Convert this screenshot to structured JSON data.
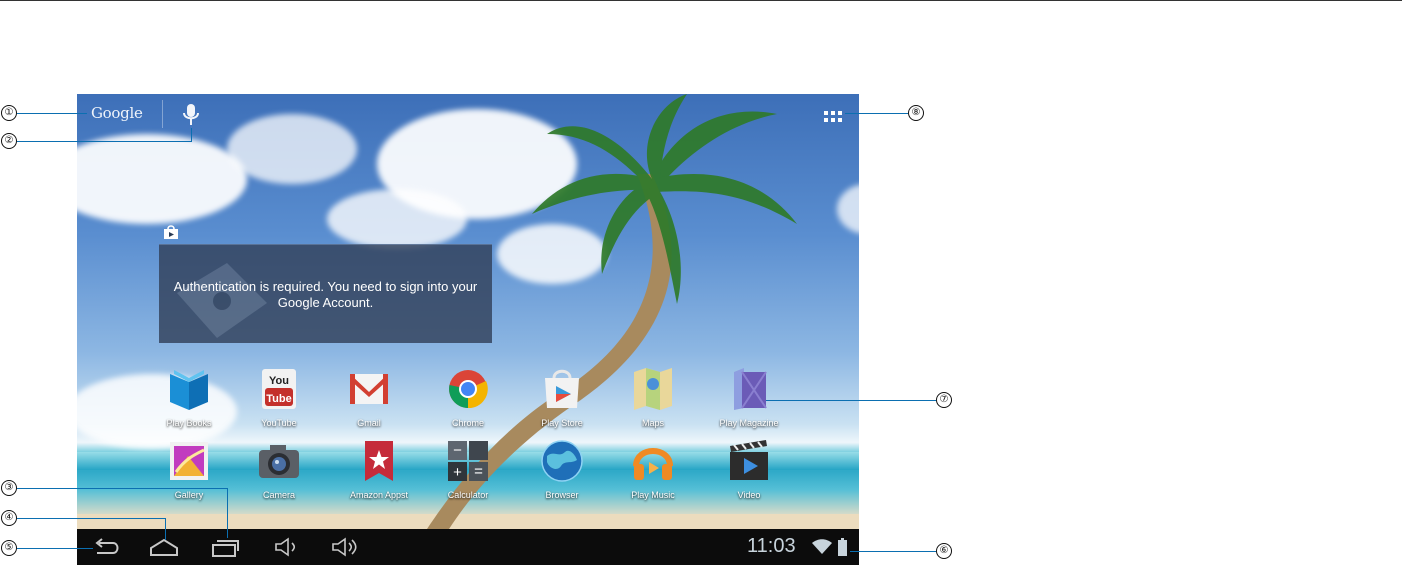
{
  "search": {
    "logo": "Google"
  },
  "widget": {
    "message": "Authentication is required. You need to sign into your Google Account."
  },
  "apps_row1": [
    {
      "label": "Play Books",
      "icon": "play-books-icon"
    },
    {
      "label": "YouTube",
      "icon": "youtube-icon"
    },
    {
      "label": "Gmail",
      "icon": "gmail-icon"
    },
    {
      "label": "Chrome",
      "icon": "chrome-icon"
    },
    {
      "label": "Play Store",
      "icon": "play-store-icon"
    },
    {
      "label": "Maps",
      "icon": "maps-icon"
    },
    {
      "label": "Play Magazine",
      "icon": "play-magazine-icon"
    }
  ],
  "apps_row2": [
    {
      "label": "Gallery",
      "icon": "gallery-icon"
    },
    {
      "label": "Camera",
      "icon": "camera-icon"
    },
    {
      "label": "Amazon Appst",
      "icon": "amazon-appstore-icon"
    },
    {
      "label": "Calculator",
      "icon": "calculator-icon"
    },
    {
      "label": "Browser",
      "icon": "browser-icon"
    },
    {
      "label": "Play Music",
      "icon": "play-music-icon"
    },
    {
      "label": "Video",
      "icon": "video-icon"
    }
  ],
  "status": {
    "time": "11:03"
  },
  "youtube": {
    "top": "You",
    "bottom": "Tube"
  },
  "calculator": {
    "minus": "−",
    "equals": "=",
    "plus": "+"
  },
  "callouts": [
    "①",
    "②",
    "③",
    "④",
    "⑤",
    "⑥",
    "⑦",
    "⑧"
  ],
  "colors": {
    "accent": "#0b6fb1",
    "navbar": "#0c0c0c",
    "clock": "#c8d4dc"
  }
}
